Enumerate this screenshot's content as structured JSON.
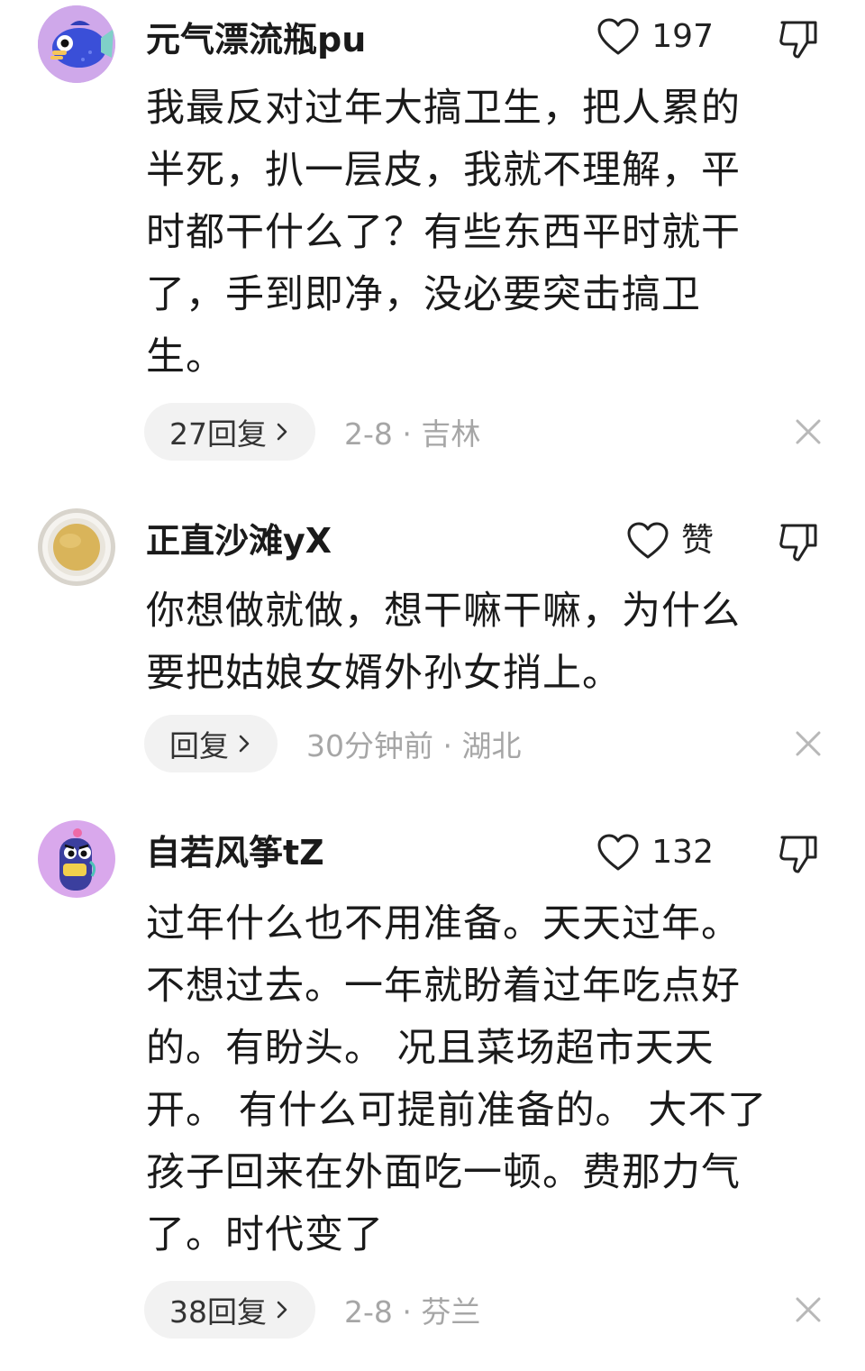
{
  "comments": [
    {
      "username": "元气漂流瓶pu",
      "avatar_icon": "blue-fish-avatar",
      "like_count": "197",
      "text_lines": [
        "我最反对过年大搞卫生，把人累的",
        "半死，扒一层皮，我就不理解，平",
        "时都干什么了？有些东西平时就干",
        "了，手到即净，没必要突击搞卫",
        "生。"
      ],
      "reply_label": "27回复",
      "meta": "2-8 · 吉林"
    },
    {
      "username": "正直沙滩yX",
      "avatar_icon": "tea-cup-avatar",
      "like_count": "赞",
      "text_lines": [
        "你想做就做，想干嘛干嘛，为什么",
        "要把姑娘女婿外孙女捎上。"
      ],
      "reply_label": "回复",
      "meta": "30分钟前 · 湖北"
    },
    {
      "username": "自若风筝tZ",
      "avatar_icon": "purple-monster-avatar",
      "like_count": "132",
      "text_lines": [
        "过年什么也不用准备。天天过年。",
        "不想过去。一年就盼着过年吃点好",
        "的。有盼头。 况且菜场超市天天",
        "开。 有什么可提前准备的。 大不了",
        "孩子回来在外面吃一顿。费那力气",
        "了。时代变了"
      ],
      "reply_label": "38回复",
      "meta": "2-8 · 芬兰"
    }
  ]
}
